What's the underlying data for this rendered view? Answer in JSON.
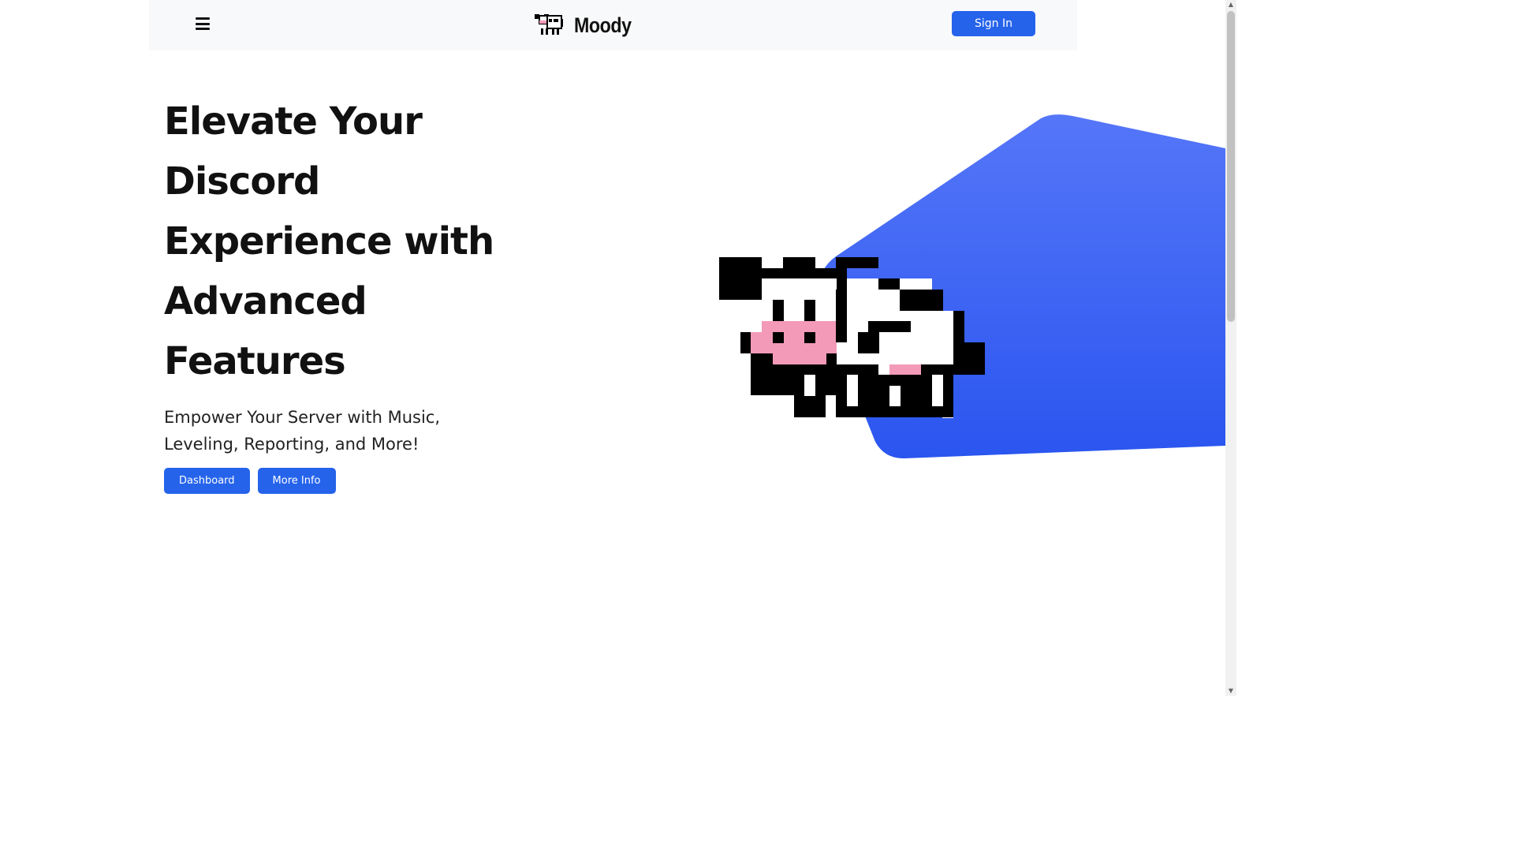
{
  "navbar": {
    "brand_name": "Moody",
    "signin_label": "Sign In"
  },
  "hero": {
    "title": "Elevate Your Discord Experience with Advanced Features",
    "subtitle": "Empower Your Server with Music, Leveling, Reporting, and More!",
    "buttons": {
      "dashboard_label": "Dashboard",
      "more_info_label": "More Info"
    }
  },
  "colors": {
    "accent": "#2563eb",
    "navbar_bg": "#f8f9fa",
    "shape_top": "#4d73f7",
    "shape_bottom": "#2c58f0",
    "cow_pink": "#f39ab8"
  },
  "icons": {
    "menu": "hamburger-menu-icon",
    "logo": "pixel-cow-logo",
    "hero_image": "pixel-cow-illustration"
  }
}
